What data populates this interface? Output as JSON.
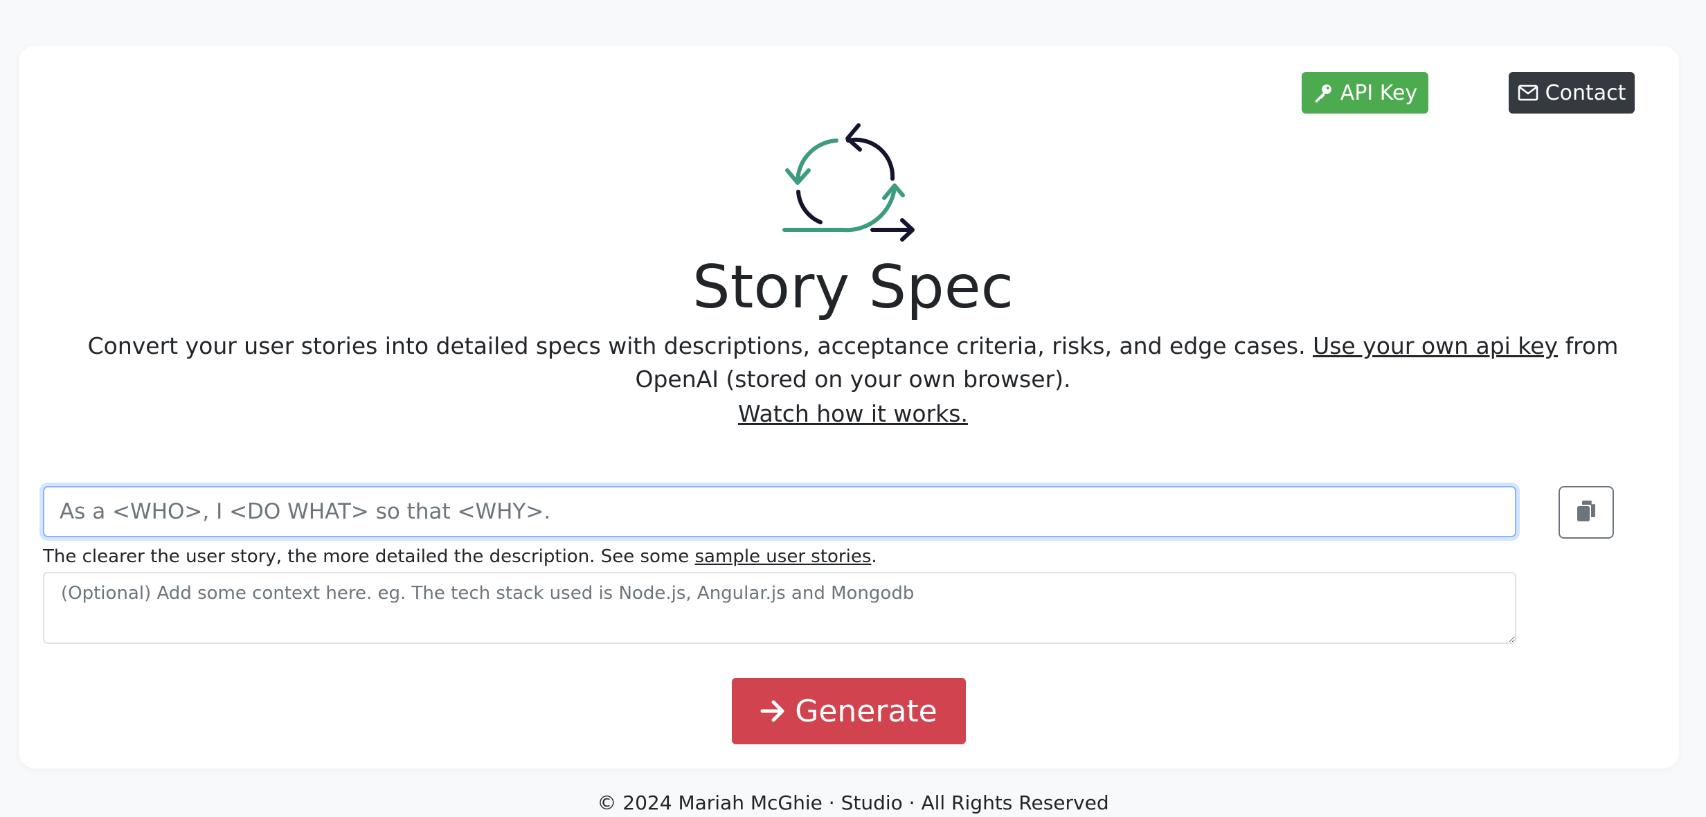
{
  "header": {
    "api_key_label": "API Key",
    "contact_label": "Contact"
  },
  "hero": {
    "title": "Story Spec",
    "subtitle_text": "Convert your user stories into detailed specs with descriptions, acceptance criteria, risks, and edge cases. ",
    "subtitle_link": "Use your own api key",
    "subtitle_suffix": " from OpenAI (stored on your own browser).",
    "watch_link": "Watch how it works."
  },
  "form": {
    "story_placeholder": "As a <WHO>, I <DO WHAT> so that <WHY>.",
    "story_value": "",
    "hint_text": "The clearer the user story, the more detailed the description. See some ",
    "hint_link": "sample user stories",
    "hint_suffix": ".",
    "context_placeholder": "(Optional) Add some context here. eg. The tech stack used is Node.js, Angular.js and Mongodb",
    "context_value": "",
    "generate_label": "Generate"
  },
  "footer": {
    "text": "© 2024 Mariah McGhie · Studio · All Rights Reserved"
  },
  "colors": {
    "api_key_button": "#4caa4f",
    "contact_button": "#343a40",
    "generate_button": "#d1434f",
    "logo_green": "#3d9c7f",
    "logo_dark": "#15142e"
  },
  "icons": {
    "api_key": "key-icon",
    "contact": "envelope-icon",
    "copy": "clipboard-icon",
    "generate": "arrow-right-icon"
  }
}
